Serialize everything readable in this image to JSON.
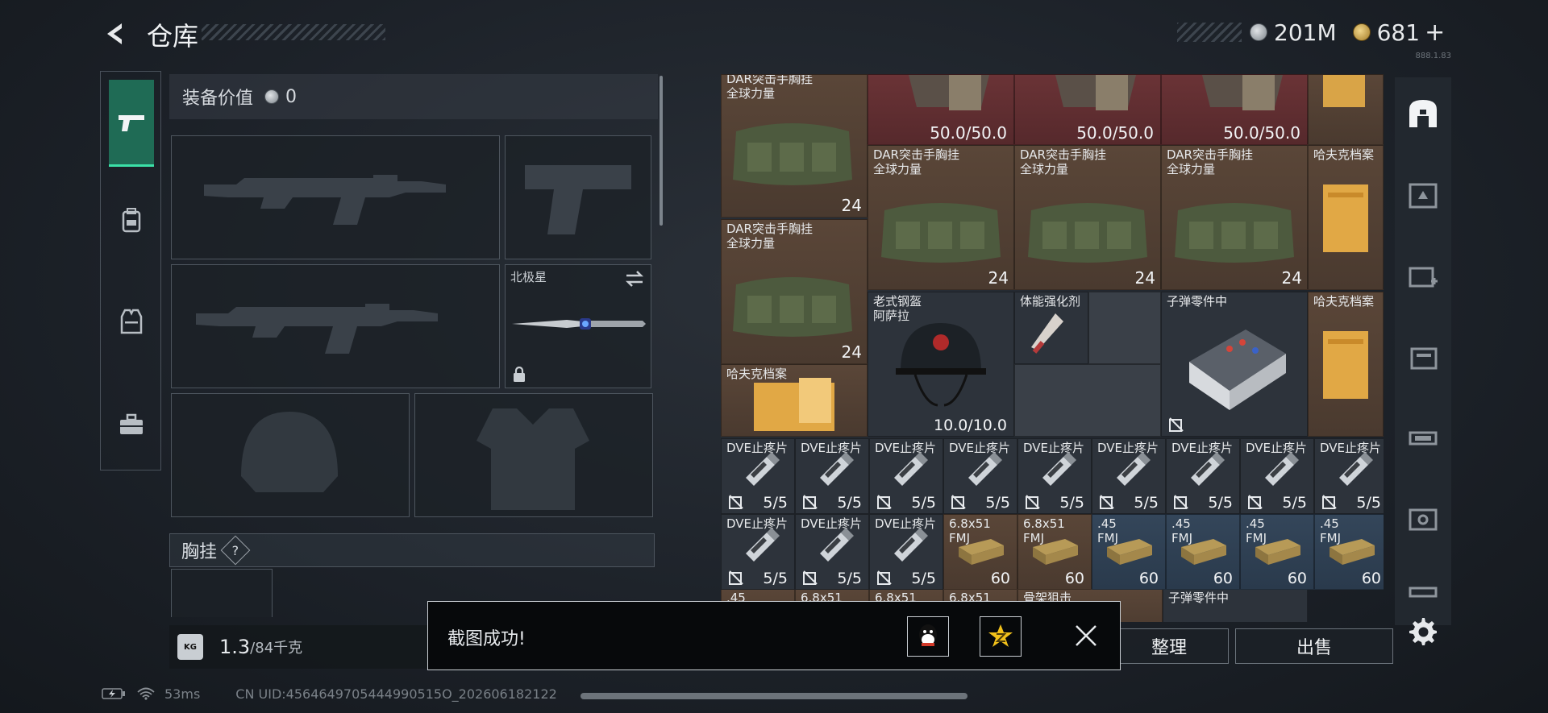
{
  "header": {
    "title": "仓库",
    "currencies": [
      {
        "icon": "silver-coin-icon",
        "value": "201M"
      },
      {
        "icon": "gold-coin-icon",
        "value": "681"
      }
    ],
    "add_symbol": "+"
  },
  "left_nav": {
    "items": [
      {
        "name": "weapons-tab",
        "icon": "pistol-icon",
        "active": true
      },
      {
        "name": "backpack-tab",
        "icon": "backpack-icon",
        "active": false
      },
      {
        "name": "armor-tab",
        "icon": "vest-icon",
        "active": false
      },
      {
        "name": "toolbox-tab",
        "icon": "toolbox-icon",
        "active": false
      }
    ]
  },
  "equipment": {
    "value_label": "装备价值",
    "value": "0",
    "melee_name": "北极星",
    "chest_label": "胸挂",
    "help_symbol": "?"
  },
  "weight": {
    "current": "1.3",
    "max": "/84千克",
    "icon_text": "KG"
  },
  "status": {
    "ping": "53ms",
    "uid": "CN UID:4564649705444990515O_202606182122"
  },
  "inventory": {
    "items": [
      {
        "name": "DAR突击手胸挂\n全球力量",
        "count": "24"
      },
      {
        "name": "",
        "count": "50.0/50.0"
      },
      {
        "name": "",
        "count": "50.0/50.0"
      },
      {
        "name": "",
        "count": "50.0/50.0"
      },
      {
        "name": "DAR突击手胸挂\n全球力量",
        "count": "24"
      },
      {
        "name": "DAR突击手胸挂\n全球力量",
        "count": "24"
      },
      {
        "name": "DAR突击手胸挂\n全球力量",
        "count": "24"
      },
      {
        "name": "哈夫克档案",
        "count": ""
      },
      {
        "name": "DAR突击手胸挂\n全球力量",
        "count": "24"
      },
      {
        "name": "老式钢盔\n阿萨拉",
        "count": "10.0/10.0"
      },
      {
        "name": "体能强化剂",
        "count": ""
      },
      {
        "name": "子弹零件中",
        "count": ""
      },
      {
        "name": "哈夫克档案",
        "count": ""
      },
      {
        "name": "哈夫克档案",
        "count": ""
      },
      {
        "name": "DVE止疼片",
        "count": "5/5"
      },
      {
        "name": "6.8x51\nFMJ",
        "count": "60"
      },
      {
        "name": ".45\nFMJ",
        "count": "60"
      },
      {
        "name": ".45",
        "count": ""
      },
      {
        "name": "6.8x51",
        "count": ""
      },
      {
        "name": "骨架狙击",
        "count": ""
      },
      {
        "name": "子弹零件中",
        "count": ""
      }
    ]
  },
  "actions": {
    "tidy": "整理",
    "sell": "出售"
  },
  "toast": {
    "message": "截图成功!",
    "share_qq": "qq-icon",
    "share_qzone": "qzone-star-icon"
  },
  "version_text": "888.1.83"
}
